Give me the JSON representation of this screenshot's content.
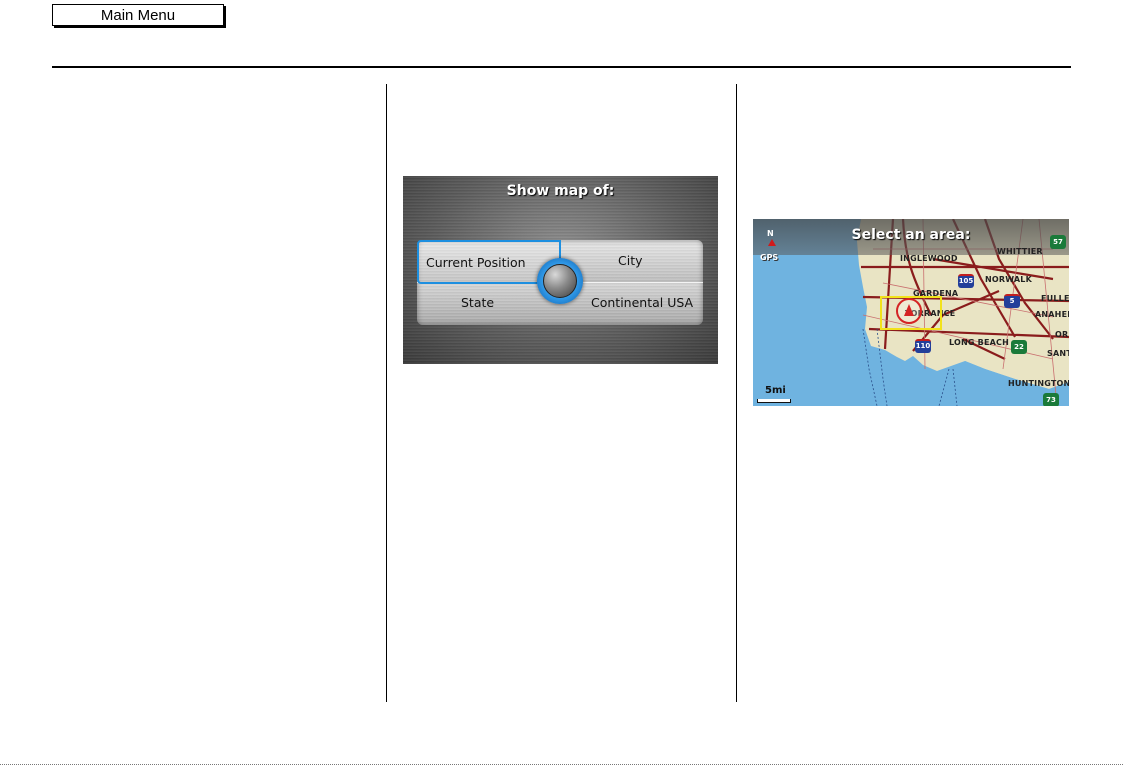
{
  "header": {
    "main_menu_label": "Main Menu"
  },
  "show_map": {
    "title": "Show map of:",
    "options": {
      "current_position": "Current Position",
      "city": "City",
      "state": "State",
      "continental_usa": "Continental USA"
    },
    "selected": "Current Position"
  },
  "area_map": {
    "title": "Select an area:",
    "north_label": "N",
    "gps_label": "GPS",
    "scale_label": "5mi",
    "cities": {
      "whittier": "WHITTIER",
      "inglewood": "INGLEWOOD",
      "norwalk": "NORWALK",
      "gardena": "GARDENA",
      "fullerton": "FULLERT",
      "torrance": "TORRANCE",
      "anaheim": "ANAHEI",
      "orange": "OR",
      "long_beach": "LONG BEACH",
      "santa_ana": "SANT",
      "huntington": "HUNTINGTON"
    },
    "shields": {
      "i105": "105",
      "i5": "5",
      "i110": "110",
      "sr22": "22",
      "sr57": "57",
      "sr73": "73"
    },
    "colors": {
      "water": "#6fb3e0",
      "land": "#e9e4c4",
      "freeway": "#8a1c1c",
      "selection": "#f2e21a"
    }
  }
}
